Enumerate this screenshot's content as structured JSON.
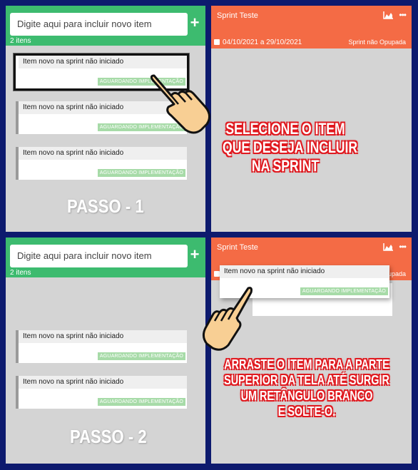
{
  "backlog": {
    "input_placeholder": "Digite aqui para incluir novo item",
    "count": "2 itens",
    "card_title": "Item novo na sprint não iniciado",
    "card_status": "AGUARDANDO IMPLEMENTAÇÃO"
  },
  "sprint": {
    "name": "Sprint Teste",
    "dates": "04/10/2021 a 29/10/2021",
    "status": "Sprint não Opupada",
    "status_partial": "upada"
  },
  "steps": {
    "step1": "PASSO - 1",
    "step2": "PASSO - 2"
  },
  "instructions": {
    "step1_lines": [
      "SELECIONE O ITEM",
      "QUE DESEJA INCLUIR",
      "NA SPRINT"
    ],
    "step2_lines": [
      "ARRASTE O ITEM PARA A PARTE",
      "SUPERIOR DA TELA ATÉ SURGIR",
      "UM RETÂNGULO BRANCO",
      "E SOLTE-O."
    ]
  },
  "colors": {
    "backlog_header": "#3dbb6f",
    "sprint_header": "#f46b45",
    "status_badge": "#a7dba8",
    "instruction_outline": "#e0191f",
    "background": "#0d1a6e"
  },
  "icons": [
    "plus-icon",
    "chart-icon",
    "more-icon",
    "calendar-icon",
    "hand-pointer-icon"
  ]
}
